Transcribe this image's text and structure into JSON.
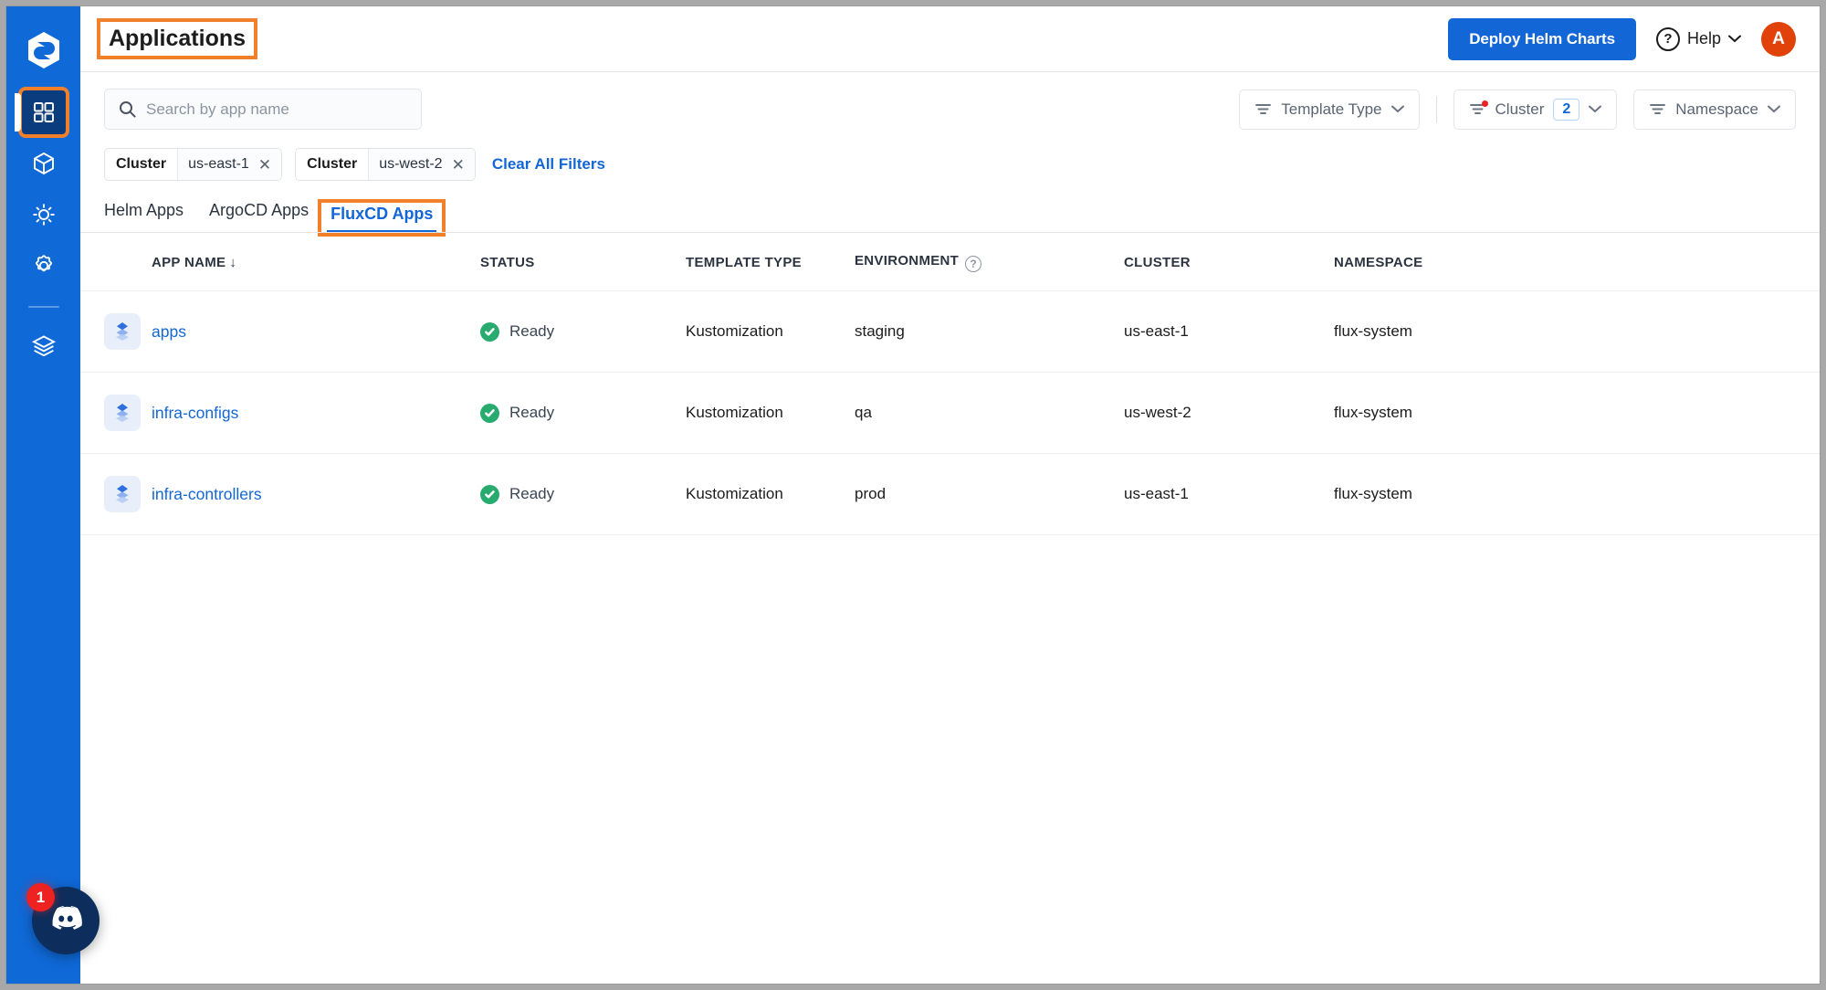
{
  "brand": {
    "logo_icon": "devtron-logo"
  },
  "sidebar": {
    "items": [
      {
        "id": "applications",
        "icon": "grid-apps-icon",
        "active": true,
        "highlighted": true
      },
      {
        "id": "chart-store",
        "icon": "cube-icon",
        "active": false,
        "highlighted": false
      },
      {
        "id": "jobs",
        "icon": "sun-gear-icon",
        "active": false,
        "highlighted": false
      },
      {
        "id": "global-config",
        "icon": "gear-icon",
        "active": false,
        "highlighted": false
      },
      {
        "id": "resource-browser",
        "icon": "layers-icon",
        "active": false,
        "highlighted": false
      }
    ]
  },
  "chat": {
    "icon": "discord-icon",
    "badge": "1"
  },
  "header": {
    "title": "Applications",
    "deploy_button": "Deploy Helm Charts",
    "help_label": "Help",
    "help_icon": "question-circle-icon",
    "avatar_initial": "A"
  },
  "search": {
    "placeholder": "Search by app name",
    "value": "",
    "icon": "search-icon"
  },
  "filters": {
    "template_type": {
      "label": "Template Type",
      "icon": "filter-icon",
      "count": "",
      "has_indicator": false
    },
    "cluster": {
      "label": "Cluster",
      "icon": "filter-icon",
      "count": "2",
      "has_indicator": true
    },
    "namespace": {
      "label": "Namespace",
      "icon": "filter-icon",
      "count": "",
      "has_indicator": false
    }
  },
  "chips": [
    {
      "key": "Cluster",
      "value": "us-east-1",
      "remove_icon": "close-icon"
    },
    {
      "key": "Cluster",
      "value": "us-west-2",
      "remove_icon": "close-icon"
    }
  ],
  "clear_all_filters": "Clear All Filters",
  "tabs": [
    {
      "label": "Helm Apps",
      "active": false,
      "highlighted": false
    },
    {
      "label": "ArgoCD Apps",
      "active": false,
      "highlighted": false
    },
    {
      "label": "FluxCD Apps",
      "active": true,
      "highlighted": true
    }
  ],
  "table": {
    "columns": [
      {
        "key": "icon",
        "label": ""
      },
      {
        "key": "name",
        "label": "APP NAME",
        "sort": "↓"
      },
      {
        "key": "status",
        "label": "STATUS"
      },
      {
        "key": "template",
        "label": "TEMPLATE TYPE"
      },
      {
        "key": "env",
        "label": "ENVIRONMENT",
        "info_icon": "help-circle-icon"
      },
      {
        "key": "cluster",
        "label": "CLUSTER"
      },
      {
        "key": "ns",
        "label": "NAMESPACE"
      }
    ],
    "rows": [
      {
        "icon": "fluxcd-icon",
        "name": "apps",
        "status": "Ready",
        "status_color": "#27ab6e",
        "template": "Kustomization",
        "env": "staging",
        "cluster": "us-east-1",
        "ns": "flux-system"
      },
      {
        "icon": "fluxcd-icon",
        "name": "infra-configs",
        "status": "Ready",
        "status_color": "#27ab6e",
        "template": "Kustomization",
        "env": "qa",
        "cluster": "us-west-2",
        "ns": "flux-system"
      },
      {
        "icon": "fluxcd-icon",
        "name": "infra-controllers",
        "status": "Ready",
        "status_color": "#27ab6e",
        "template": "Kustomization",
        "env": "prod",
        "cluster": "us-east-1",
        "ns": "flux-system"
      }
    ]
  },
  "colors": {
    "sidebar_blue": "#0f69d7",
    "sidebar_active": "#0b3c7e",
    "accent_blue": "#1366d6",
    "highlight_orange": "#f2802a",
    "status_green": "#27ab6e",
    "avatar_orange": "#e0420a",
    "badge_red": "#ef2222",
    "discord_navy": "#0d2e5c"
  }
}
